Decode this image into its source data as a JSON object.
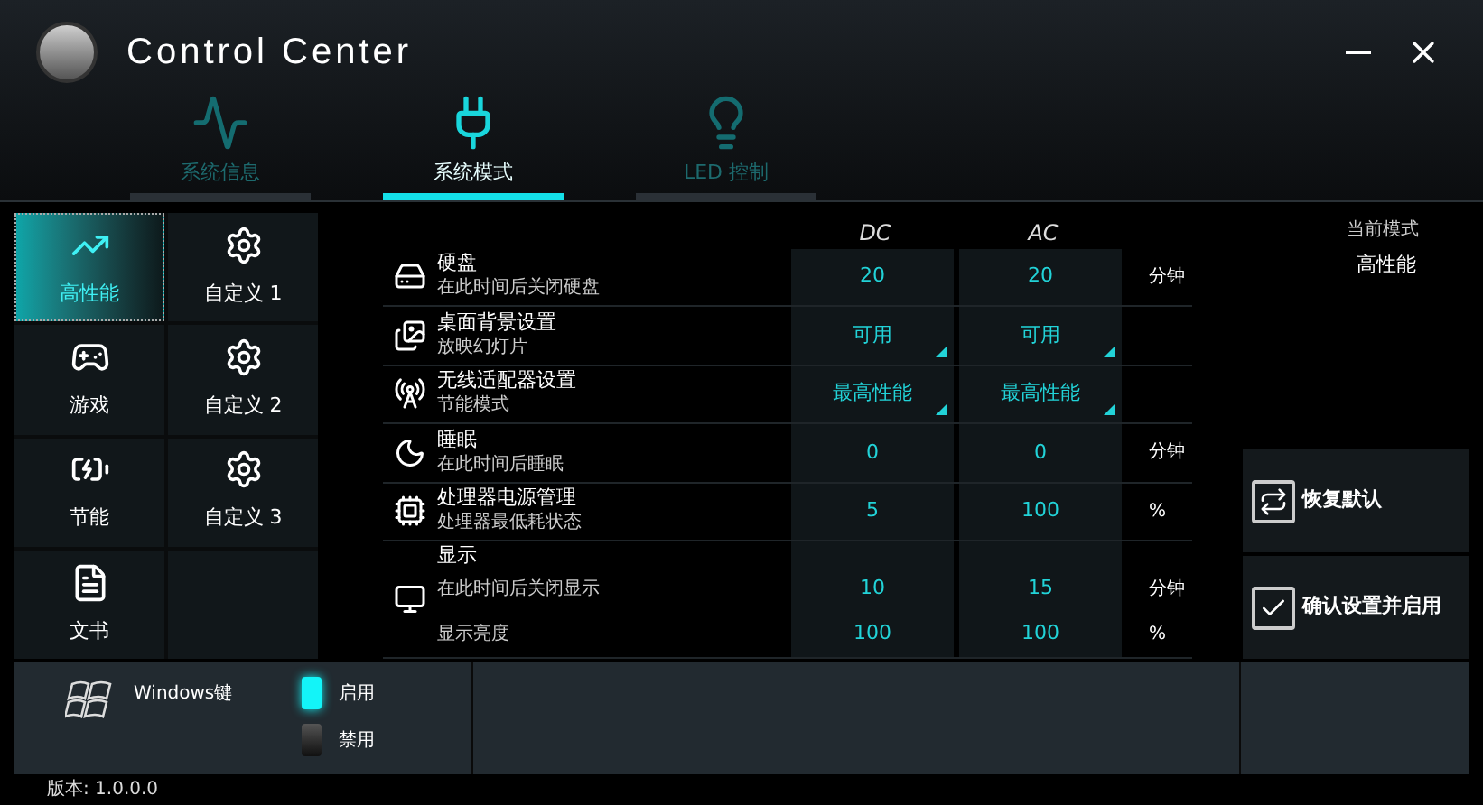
{
  "window": {
    "title": "Control Center"
  },
  "nav_tabs": [
    {
      "label": "系统信息",
      "selected": false,
      "kind": "monitor"
    },
    {
      "label": "系统模式",
      "selected": true,
      "kind": "plug"
    },
    {
      "label": "LED 控制",
      "selected": false,
      "kind": "led"
    }
  ],
  "modes": [
    {
      "label": "高性能",
      "selected": true,
      "kind": "performance"
    },
    {
      "label": "自定义 1",
      "selected": false,
      "kind": "custom"
    },
    {
      "label": "游戏",
      "selected": false,
      "kind": "game"
    },
    {
      "label": "自定义 2",
      "selected": false,
      "kind": "custom"
    },
    {
      "label": "节能",
      "selected": false,
      "kind": "battery"
    },
    {
      "label": "自定义 3",
      "selected": false,
      "kind": "custom"
    },
    {
      "label": "文书",
      "selected": false,
      "kind": "document"
    }
  ],
  "columns": [
    "DC",
    "AC"
  ],
  "settings": [
    {
      "kind": "disk",
      "title": "硬盘",
      "lines": [
        {
          "subtitle": "在此时间后关闭硬盘",
          "dc": "20",
          "ac": "20",
          "unit": "分钟",
          "kind": "number"
        }
      ]
    },
    {
      "kind": "wallpaper",
      "title": "桌面背景设置",
      "lines": [
        {
          "subtitle": "放映幻灯片",
          "dc": "可用",
          "ac": "可用",
          "kind": "dropdown"
        }
      ]
    },
    {
      "kind": "wireless",
      "title": "无线适配器设置",
      "lines": [
        {
          "subtitle": "节能模式",
          "dc": "最高性能",
          "ac": "最高性能",
          "kind": "dropdown"
        }
      ]
    },
    {
      "kind": "sleep",
      "title": "睡眠",
      "lines": [
        {
          "subtitle": "在此时间后睡眠",
          "dc": "0",
          "ac": "0",
          "unit": "分钟",
          "kind": "number"
        }
      ]
    },
    {
      "kind": "cpu",
      "title": "处理器电源管理",
      "lines": [
        {
          "subtitle": "处理器最低耗状态",
          "dc": "5",
          "ac": "100",
          "unit": "%",
          "kind": "number"
        }
      ]
    },
    {
      "kind": "display",
      "title": "显示",
      "lines": [
        {
          "subtitle": "在此时间后关闭显示",
          "dc": "10",
          "ac": "15",
          "unit": "分钟",
          "kind": "number"
        },
        {
          "subtitle": "显示亮度",
          "dc": "100",
          "ac": "100",
          "unit": "%",
          "kind": "number"
        }
      ]
    }
  ],
  "current_mode": {
    "label": "当前模式",
    "value": "高性能"
  },
  "actions": [
    {
      "label": "恢复默认",
      "kind": "restore"
    },
    {
      "label": "确认设置并启用",
      "kind": "confirm"
    }
  ],
  "windows_key": {
    "label": "Windows键",
    "options": [
      {
        "label": "启用",
        "selected": true
      },
      {
        "label": "禁用",
        "selected": false
      }
    ]
  },
  "version": "版本: 1.0.0.0"
}
